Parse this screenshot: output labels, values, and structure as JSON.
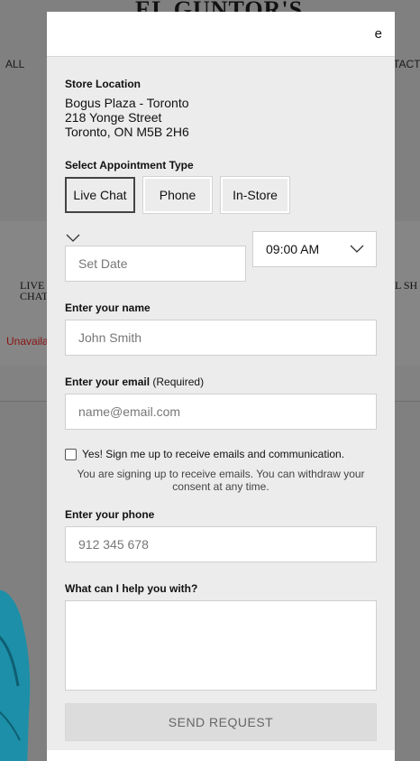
{
  "background": {
    "logo": "EL GUNTOR'S",
    "nav_left": "ALL",
    "nav_right": "TACT",
    "live_chat_line1": "LIVE",
    "live_chat_line2": "CHAT",
    "right_label": "L SH",
    "unavailable_text": "Unavaila"
  },
  "modal": {
    "close_glyph": "e",
    "store": {
      "label": "Store Location",
      "address_line1": "Bogus Plaza - Toronto",
      "address_line2": "218 Yonge Street",
      "address_line3": "Toronto, ON M5B 2H6"
    },
    "appointment": {
      "label": "Select Appointment Type",
      "options": [
        "Live Chat",
        "Phone",
        "In-Store"
      ],
      "selected": "Live Chat"
    },
    "date": {
      "placeholder": "Set Date"
    },
    "time": {
      "value": "09:00 AM"
    },
    "name": {
      "label": "Enter your name",
      "placeholder": "John Smith"
    },
    "email": {
      "label": "Enter your email",
      "required_text": "(Required)",
      "placeholder": "name@email.com"
    },
    "signup": {
      "checkbox_label": "Yes! Sign me up to receive emails and communication.",
      "note": "You are signing up to receive emails. You can withdraw your consent at any time."
    },
    "phone": {
      "label": "Enter your phone",
      "placeholder": "912 345 678"
    },
    "help": {
      "label": "What can I help you with?"
    },
    "send_label": "SEND REQUEST"
  },
  "colors": {
    "overlay": "#808080",
    "modal_bg": "#ececec",
    "unavailable": "#8a1414",
    "jacket": "#1d8fa8"
  }
}
